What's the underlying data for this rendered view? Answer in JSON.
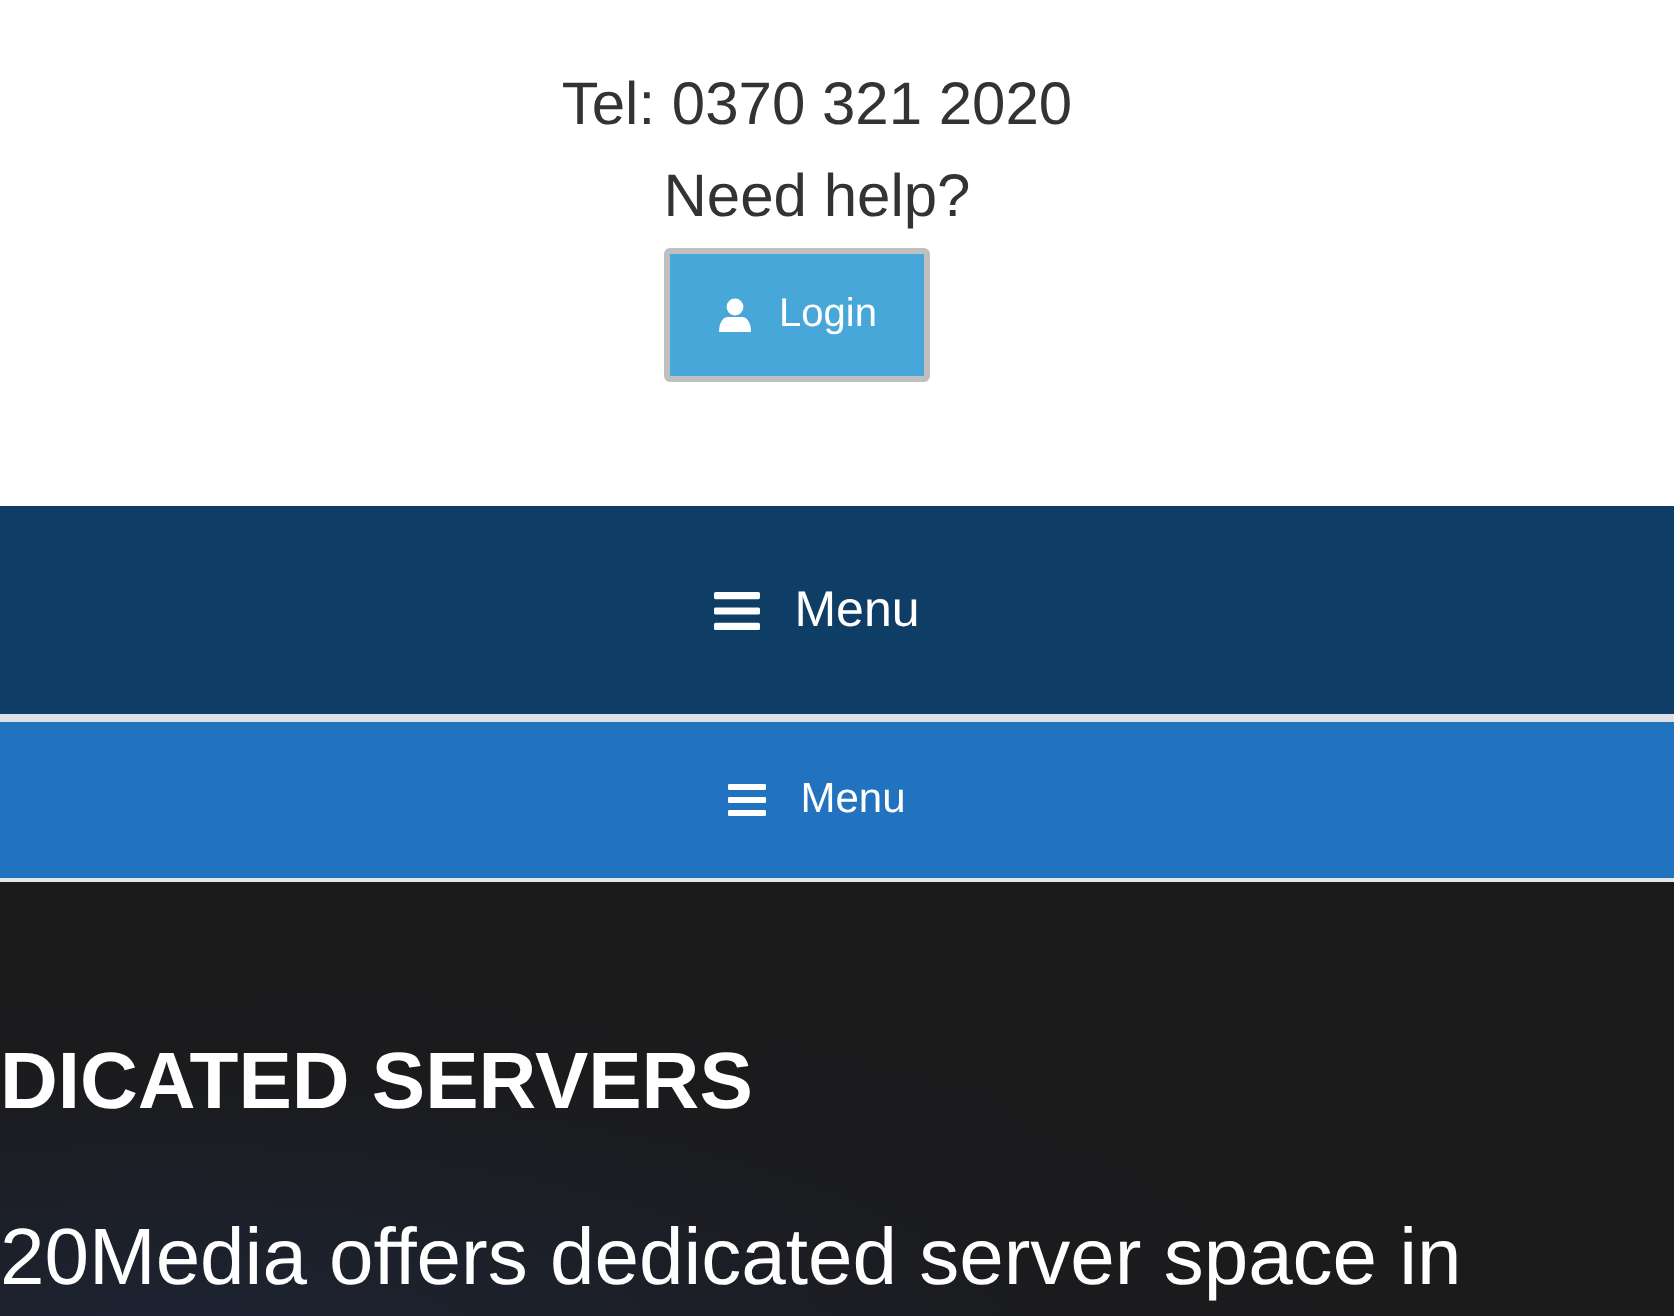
{
  "header": {
    "phone": "Tel: 0370 321 2020",
    "help": "Need help?",
    "login_button": "Login"
  },
  "nav_bars": [
    {
      "kind": "primary",
      "label": "Menu"
    },
    {
      "kind": "secondary",
      "label": "Menu"
    }
  ],
  "hero": {
    "heading": "DICATED SERVERS",
    "text": "20Media offers dedicated server space in"
  }
}
